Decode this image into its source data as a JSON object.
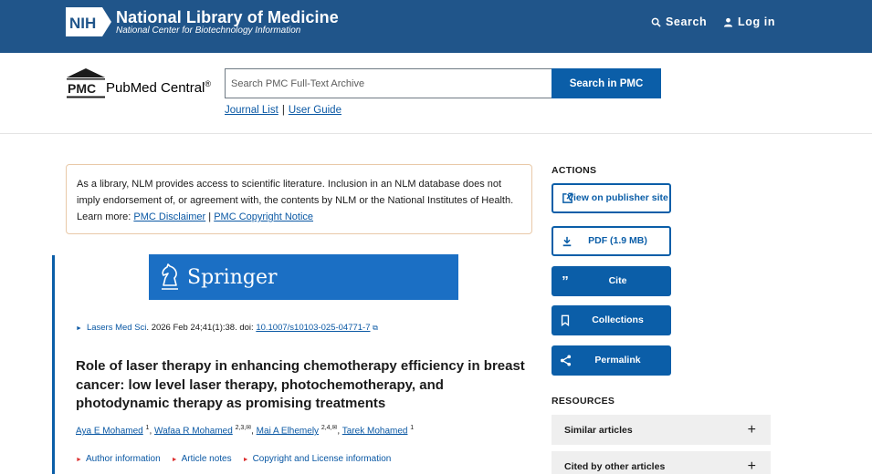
{
  "banner": {
    "nih_label": "NIH",
    "title": "National Library of Medicine",
    "subtitle": "National Center for Biotechnology Information",
    "search_label": "Search",
    "login_label": "Log in"
  },
  "pmc": {
    "logo_text": "PMC",
    "name": "PubMed Central",
    "reg": "®",
    "search_placeholder": "Search PMC Full-Text Archive",
    "search_button": "Search in PMC",
    "journal_list": "Journal List",
    "user_guide": "User Guide",
    "separator": "|"
  },
  "disclaimer": {
    "text": "As a library, NLM provides access to scientific literature. Inclusion in an NLM database does not imply endorsement of, or agreement with, the contents by NLM or the National Institutes of Health.",
    "learn_more": "Learn more:",
    "link1": "PMC Disclaimer",
    "sep": "|",
    "link2": "PMC Copyright Notice"
  },
  "article": {
    "publisher": "Springer",
    "journal": "Lasers Med Sci",
    "citation": ". 2026 Feb 24;41(1):38. doi: ",
    "doi": "10.1007/s10103-025-04771-7",
    "title": "Role of laser therapy in enhancing chemotherapy efficiency in breast cancer: low level laser therapy, photochemotherapy, and photodynamic therapy as promising treatments",
    "authors": [
      {
        "name": "Aya E Mohamed",
        "sup": "1"
      },
      {
        "name": "Wafaa R Mohamed",
        "sup": "2,3,✉"
      },
      {
        "name": "Mai A Elhemely",
        "sup": "2,4,✉"
      },
      {
        "name": "Tarek Mohamed",
        "sup": "1"
      }
    ],
    "links": [
      "Author information",
      "Article notes",
      "Copyright and License information"
    ]
  },
  "sidebar": {
    "actions_heading": "ACTIONS",
    "actions": [
      {
        "label": "View on publisher site",
        "icon": "external-link-icon"
      },
      {
        "label": "PDF (1.9 MB)",
        "icon": "download-icon"
      },
      {
        "label": "Cite",
        "icon": "quote-icon"
      },
      {
        "label": "Collections",
        "icon": "bookmark-icon"
      },
      {
        "label": "Permalink",
        "icon": "share-icon"
      }
    ],
    "resources_heading": "RESOURCES",
    "resources": [
      {
        "label": "Similar articles"
      },
      {
        "label": "Cited by other articles"
      }
    ]
  },
  "colors": {
    "banner": "#20558a",
    "accent": "#0b5ea8",
    "link": "#0a58a4",
    "springer": "#1b6fc4"
  }
}
